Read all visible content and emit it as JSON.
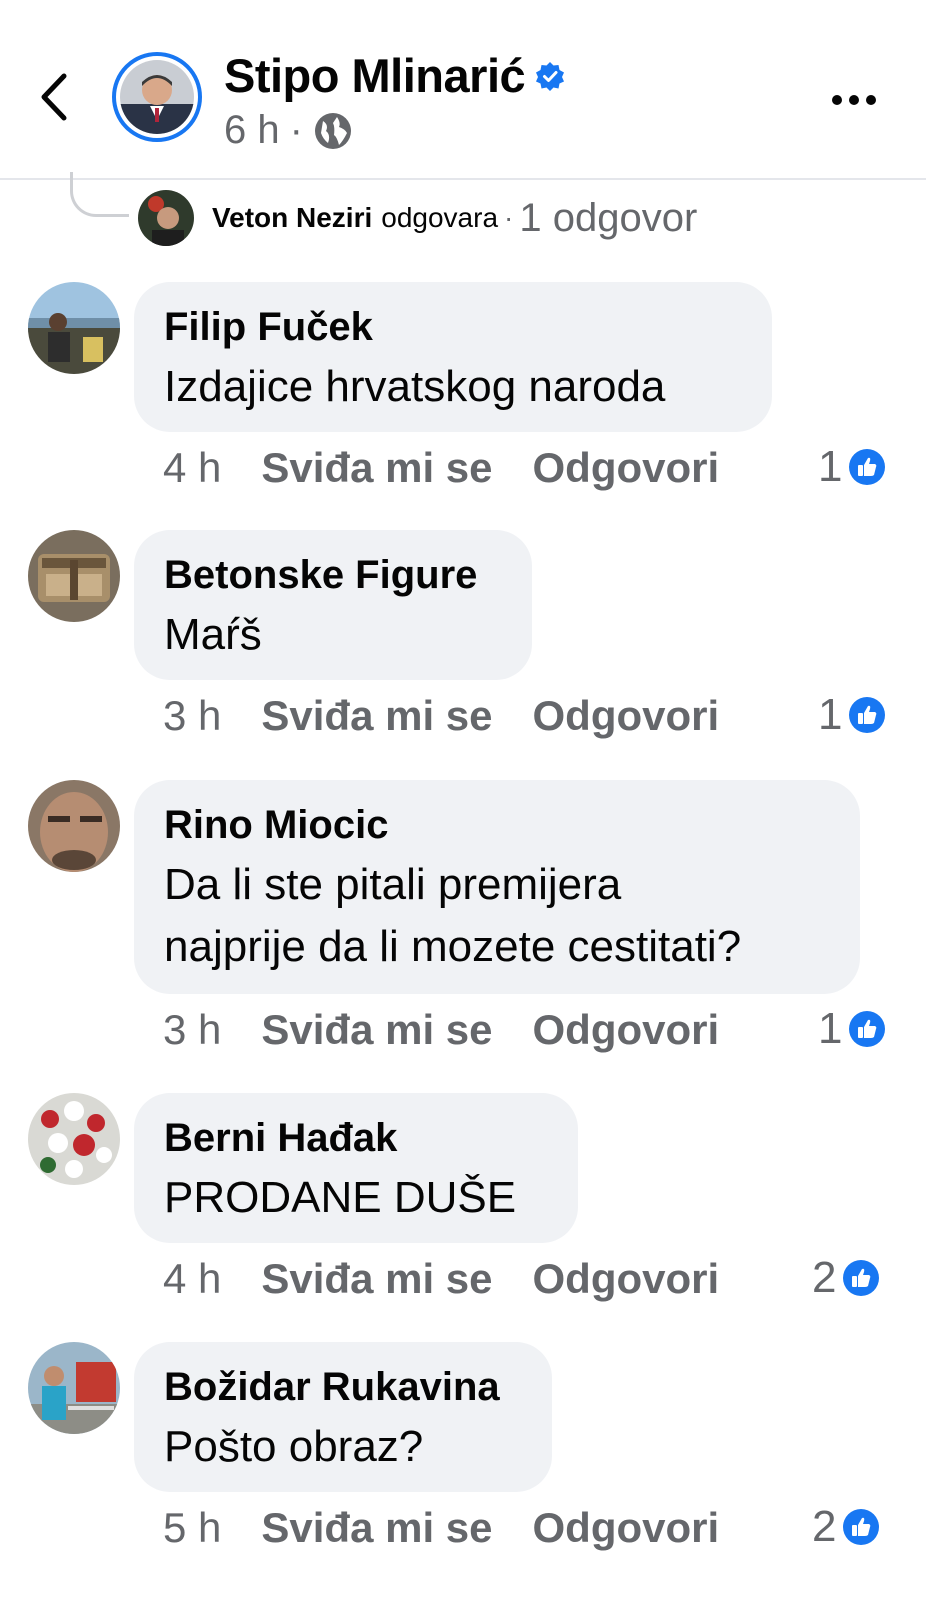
{
  "header": {
    "page_name": "Stipo Mlinarić",
    "time": "6 h",
    "separator": "·",
    "back_icon": "chevron-left-icon",
    "verified_icon": "verified-badge-icon",
    "privacy_icon": "globe-icon",
    "more_icon": "more-horizontal-icon"
  },
  "reply_preview": {
    "name": "Veton Neziri",
    "action": "odgovara",
    "separator": "·",
    "count_label": "1 odgovor"
  },
  "actions": {
    "like_label": "Sviđa mi se",
    "reply_label": "Odgovori"
  },
  "colors": {
    "accent": "#1877f2",
    "bubble": "#f0f2f5",
    "secondary_text": "#65676b"
  },
  "comments": [
    {
      "name": "Filip Fuček",
      "lines": [
        "Izdajice hrvatskog naroda"
      ],
      "time": "4 h",
      "reactions": "1"
    },
    {
      "name": "Betonske Figure",
      "lines": [
        "Maŕš"
      ],
      "time": "3 h",
      "reactions": "1"
    },
    {
      "name": "Rino Miocic",
      "lines": [
        "Da li ste pitali premijera",
        "najprije da li mozete cestitati?"
      ],
      "time": "3 h",
      "reactions": "1"
    },
    {
      "name": "Berni Hađak",
      "lines": [
        "PRODANE DUŠE"
      ],
      "time": "4 h",
      "reactions": "2"
    },
    {
      "name": "Božidar Rukavina",
      "lines": [
        "Pošto obraz?"
      ],
      "time": "5 h",
      "reactions": "2"
    }
  ]
}
